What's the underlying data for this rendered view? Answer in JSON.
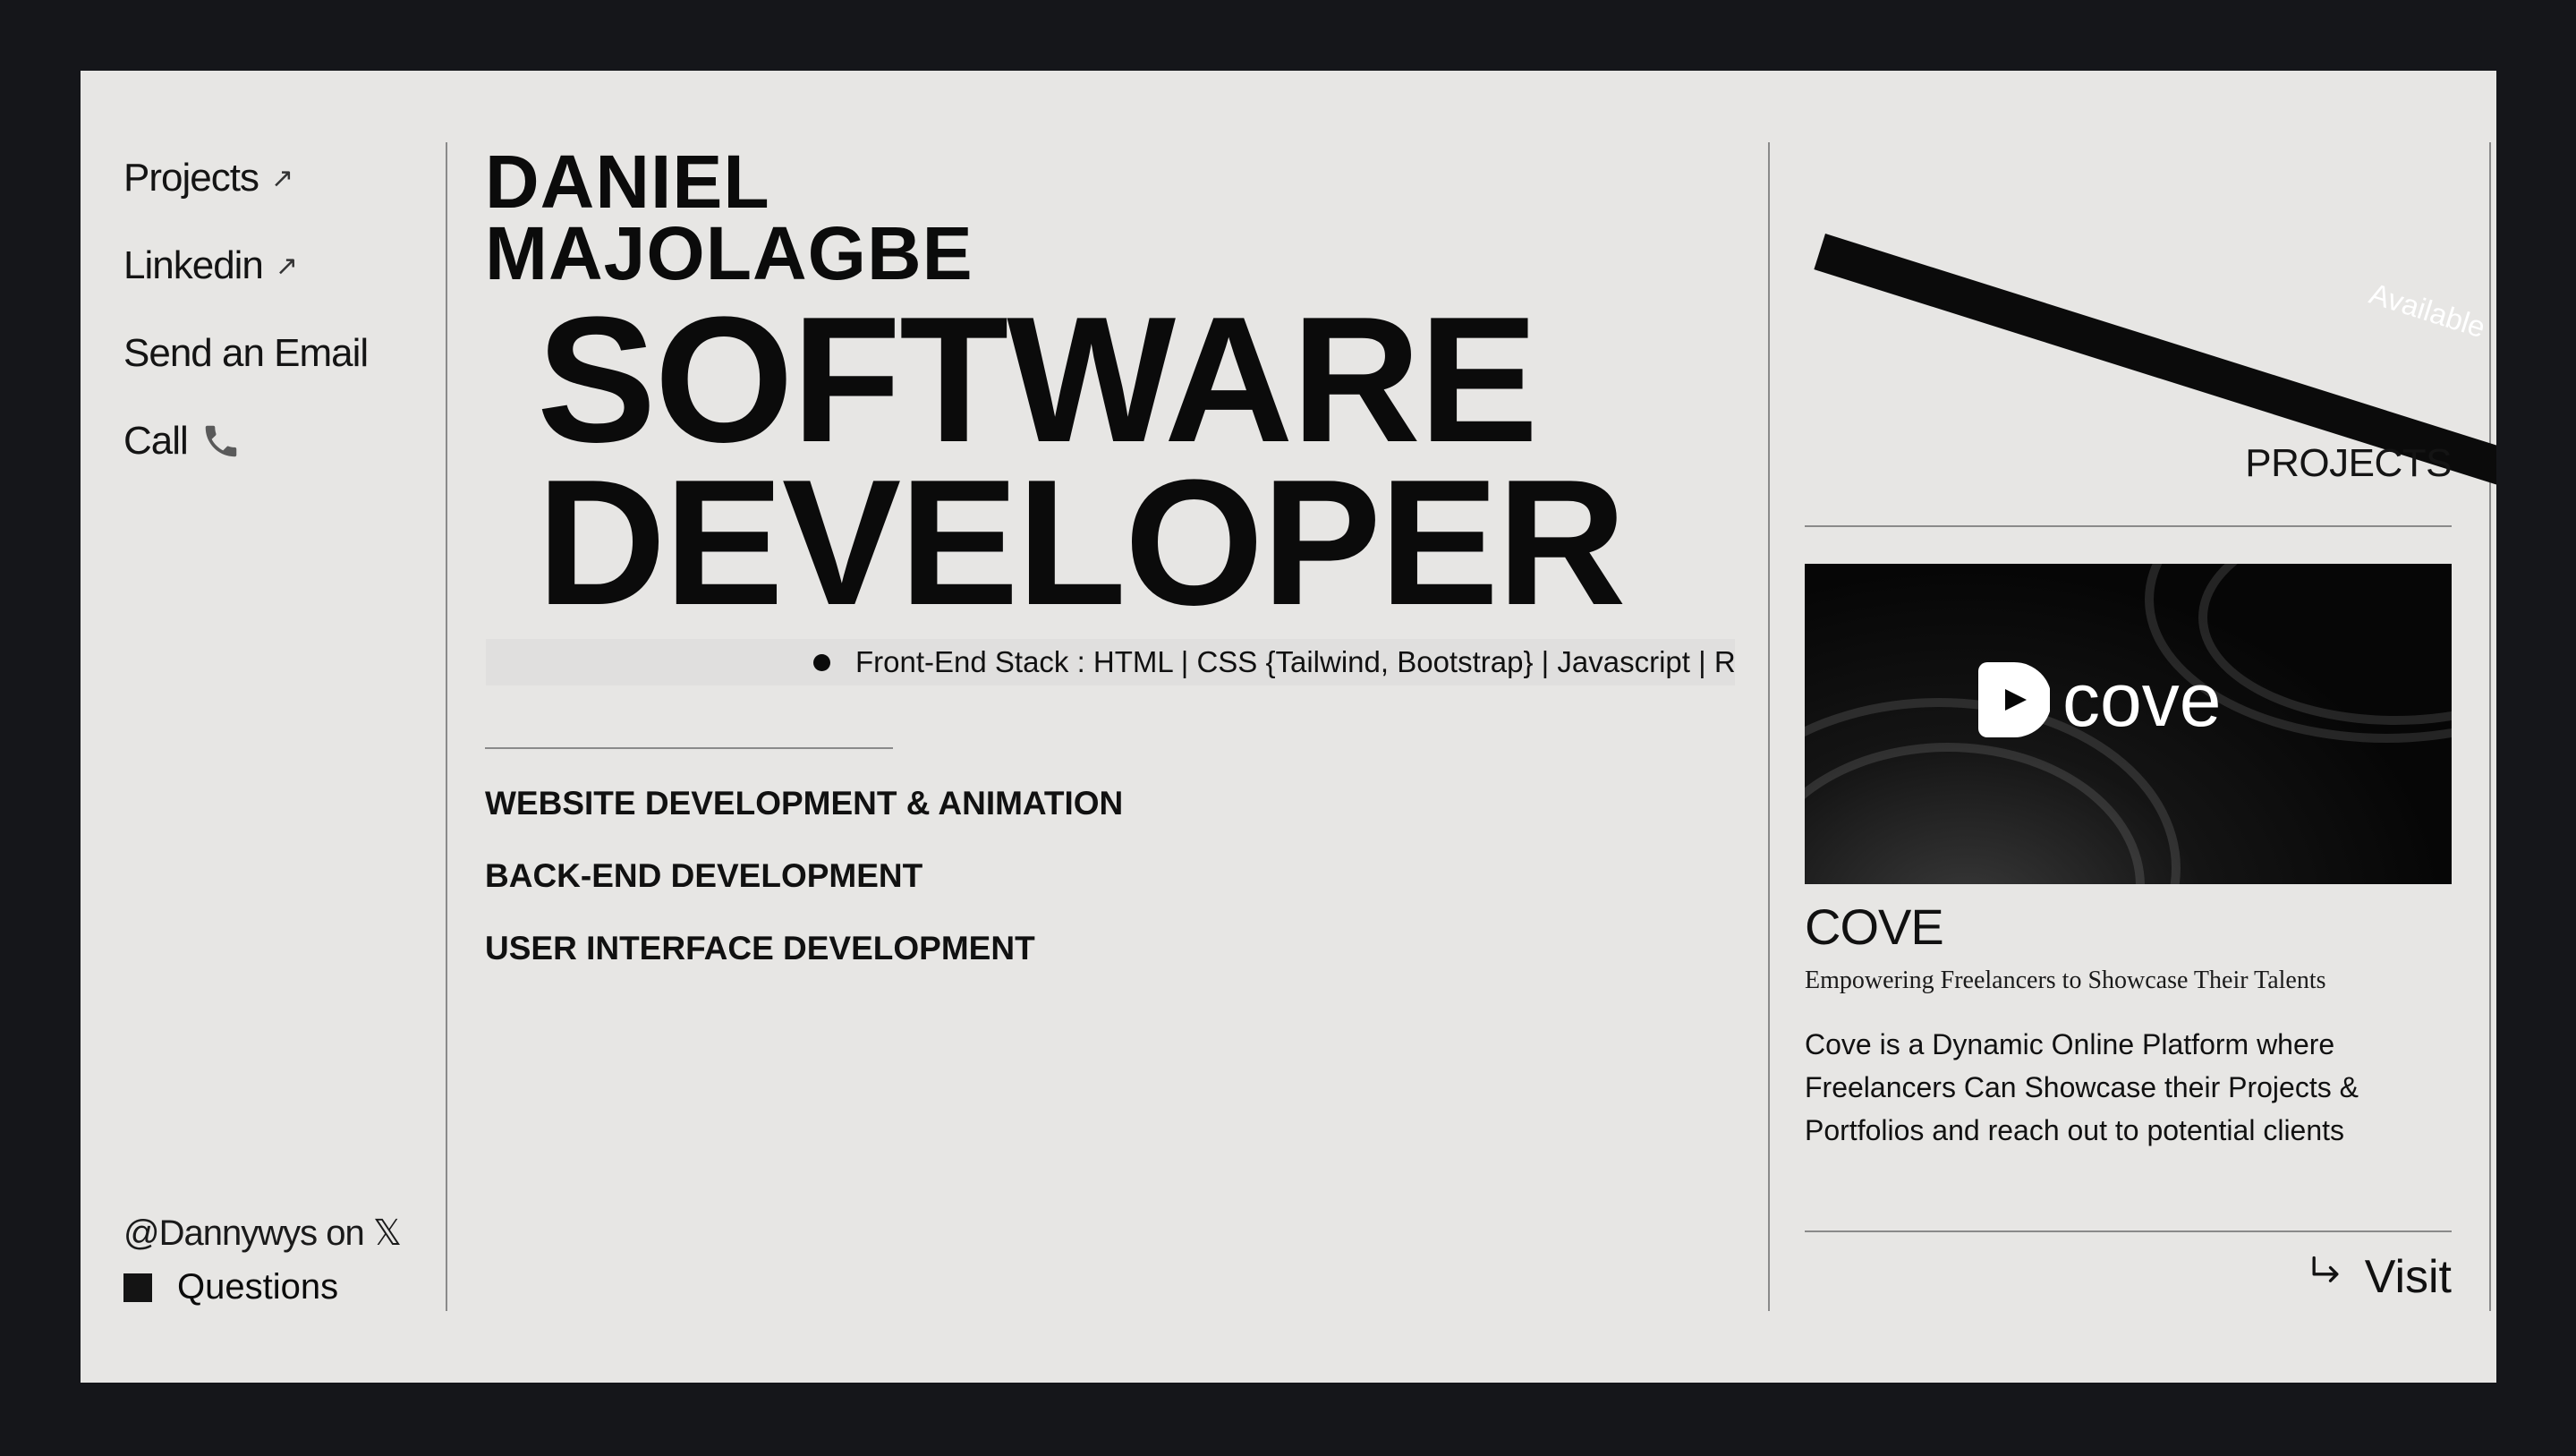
{
  "sidebar": {
    "links": [
      {
        "label": "Projects",
        "icon": "arrow-up-right-icon"
      },
      {
        "label": "Linkedin",
        "icon": "arrow-up-right-icon"
      },
      {
        "label": "Send an Email"
      },
      {
        "label": "Call",
        "icon": "phone-icon"
      }
    ],
    "social": "@Dannywys on 𝕏",
    "questions": "Questions"
  },
  "hero": {
    "first_name": "DANIEL",
    "last_name": "MAJOLAGBE",
    "role_line1": "SOFTWARE",
    "role_line2": "DEVELOPER",
    "ticker": "Front-End Stack : HTML | CSS {Tailwind, Bootstrap} | Javascript | React"
  },
  "services": [
    "WEBSITE DEVELOPMENT & ANIMATION",
    "BACK-END DEVELOPMENT",
    "USER INTERFACE DEVELOPMENT"
  ],
  "right_panel": {
    "banner_text": "Available",
    "heading": "PROJECTS",
    "project": {
      "logo_text": "cove",
      "title": "COVE",
      "tagline": "Empowering Freelancers to Showcase Their Talents",
      "description": "Cove is a Dynamic Online Platform where Freelancers Can Showcase their Projects & Portfolios and reach out to potential clients",
      "visit_label": "Visit"
    }
  },
  "colors": {
    "background": "#15161a",
    "panel": "#e7e6e4",
    "ink": "#0b0b0b",
    "rule": "#8a8a8a"
  }
}
